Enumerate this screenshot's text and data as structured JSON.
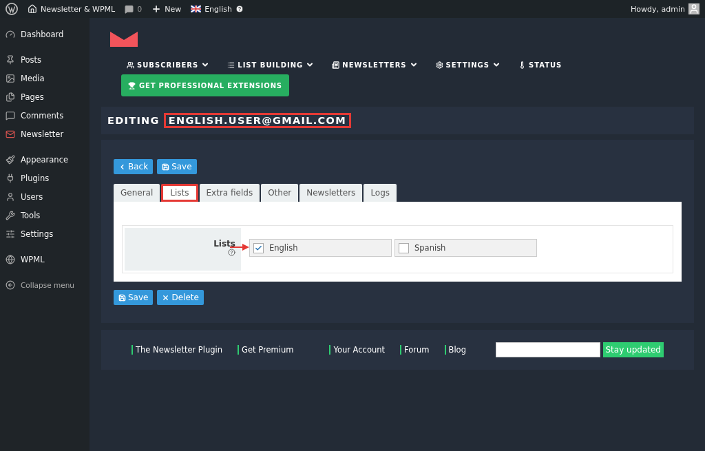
{
  "admin_bar": {
    "site": "Newsletter & WPML",
    "comments": "0",
    "new": "New",
    "language": "English",
    "greeting": "Howdy, admin"
  },
  "sidebar": {
    "groups": [
      [
        {
          "label": "Dashboard"
        }
      ],
      [
        {
          "label": "Posts"
        },
        {
          "label": "Media"
        },
        {
          "label": "Pages"
        },
        {
          "label": "Comments"
        },
        {
          "label": "Newsletter"
        }
      ],
      [
        {
          "label": "Appearance"
        },
        {
          "label": "Plugins"
        },
        {
          "label": "Users"
        },
        {
          "label": "Tools"
        },
        {
          "label": "Settings"
        }
      ],
      [
        {
          "label": "WPML"
        }
      ]
    ],
    "collapse": "Collapse menu"
  },
  "plugin_menu": [
    {
      "label": "SUBSCRIBERS",
      "dropdown": true
    },
    {
      "label": "LIST BUILDING",
      "dropdown": true
    },
    {
      "label": "NEWSLETTERS",
      "dropdown": true
    },
    {
      "label": "SETTINGS",
      "dropdown": true
    },
    {
      "label": "STATUS",
      "dropdown": false
    }
  ],
  "extensions_button": "GET PROFESSIONAL EXTENSIONS",
  "heading": {
    "prefix": "EDITING",
    "email": "ENGLISH.USER@GMAIL.COM",
    "highlighted": true
  },
  "top_buttons": [
    {
      "label": "Back",
      "kind": "back"
    },
    {
      "label": "Save",
      "kind": "save"
    }
  ],
  "tabs": [
    {
      "label": "General",
      "selected": false,
      "highlighted": false
    },
    {
      "label": "Lists",
      "selected": true,
      "highlighted": true
    },
    {
      "label": "Extra fields",
      "selected": false,
      "highlighted": false
    },
    {
      "label": "Other",
      "selected": false,
      "highlighted": false
    },
    {
      "label": "Newsletters",
      "selected": false,
      "highlighted": false
    },
    {
      "label": "Logs",
      "selected": false,
      "highlighted": false
    }
  ],
  "lists_field": {
    "label": "Lists",
    "options": [
      {
        "label": "English",
        "checked": true
      },
      {
        "label": "Spanish",
        "checked": false
      }
    ]
  },
  "bottom_buttons": [
    {
      "label": "Save",
      "kind": "save"
    },
    {
      "label": "Delete",
      "kind": "delete"
    }
  ],
  "footer": {
    "links": [
      "The Newsletter Plugin",
      "Get Premium",
      "Your Account",
      "Forum",
      "Blog"
    ],
    "subscribe_button": "Stay updated"
  }
}
